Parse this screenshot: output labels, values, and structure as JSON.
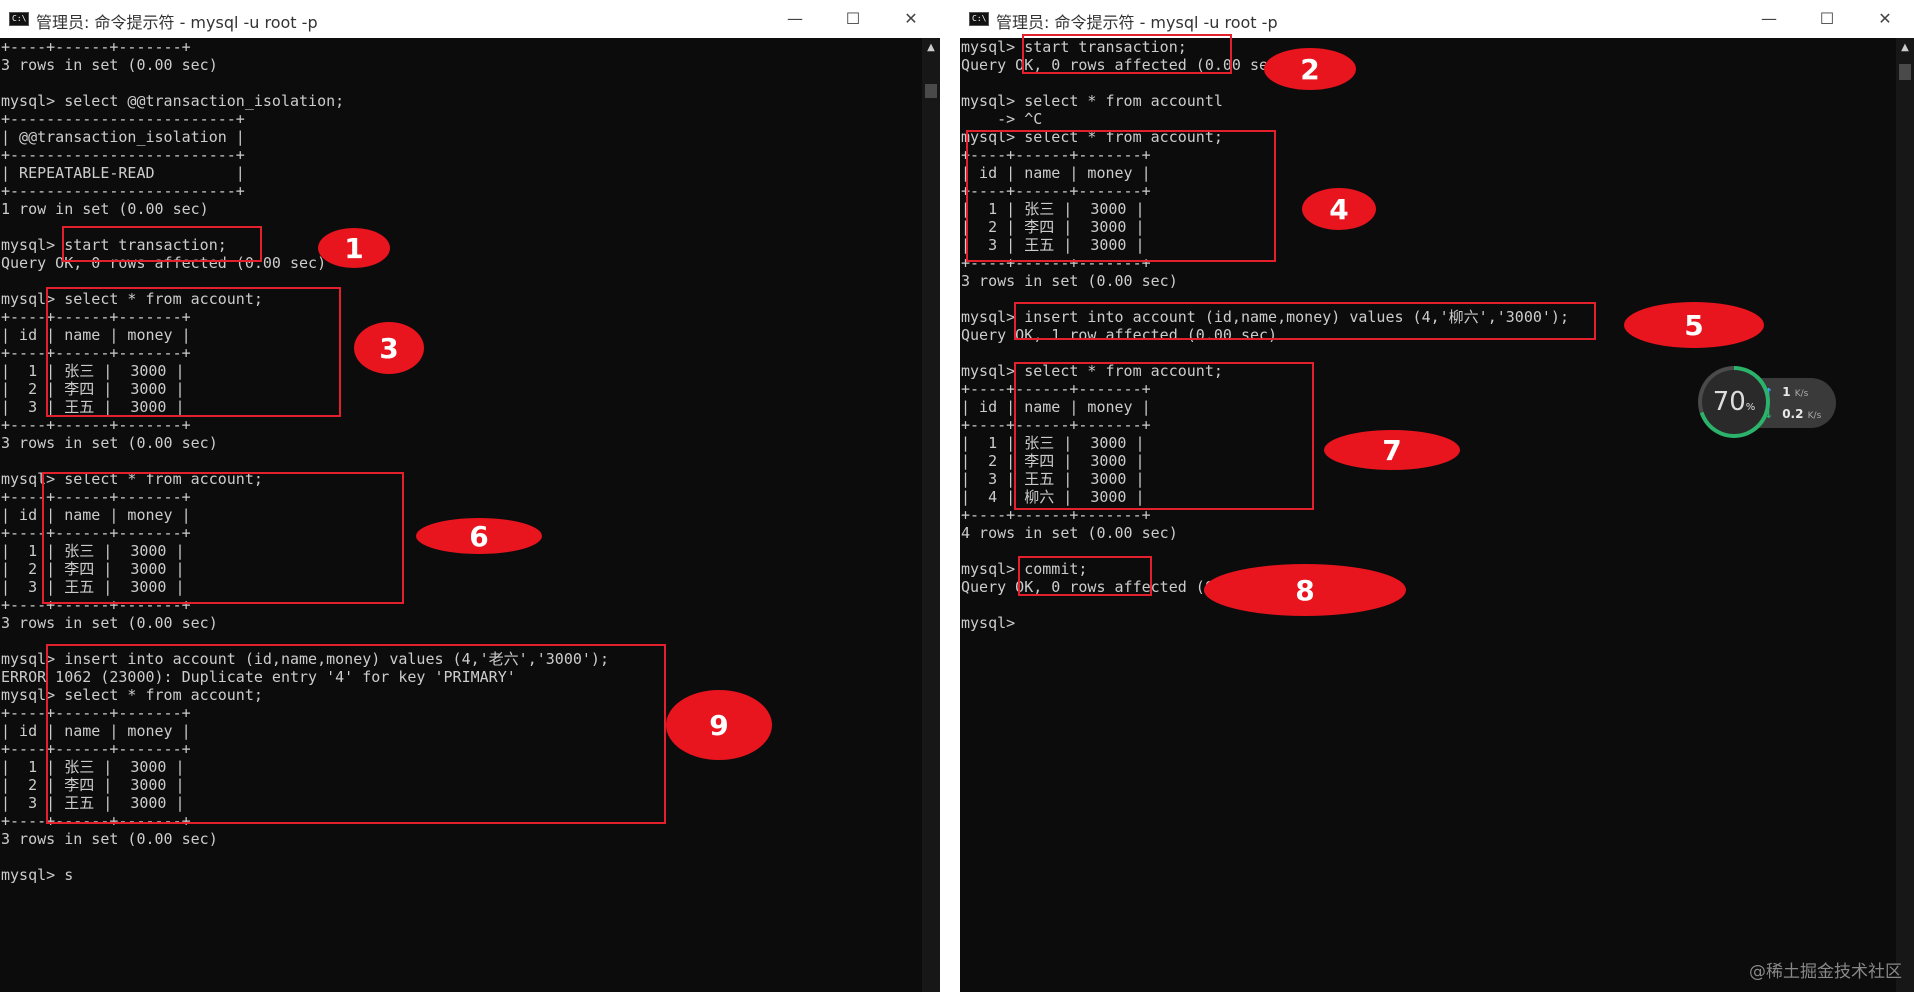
{
  "left_window": {
    "title": "管理员: 命令提示符 - mysql  -u root -p",
    "app_icon_label": "C:\\",
    "controls": {
      "minimize": "—",
      "maximize": "☐",
      "close": "✕"
    },
    "lines": [
      "+----+------+-------+",
      "3 rows in set (0.00 sec)",
      "",
      "mysql> select @@transaction_isolation;",
      "+-------------------------+",
      "| @@transaction_isolation |",
      "+-------------------------+",
      "| REPEATABLE-READ         |",
      "+-------------------------+",
      "1 row in set (0.00 sec)",
      "",
      "mysql> start transaction;",
      "Query OK, 0 rows affected (0.00 sec)",
      "",
      "mysql> select * from account;",
      "+----+------+-------+",
      "| id | name | money |",
      "+----+------+-------+",
      "|  1 | 张三 |  3000 |",
      "|  2 | 李四 |  3000 |",
      "|  3 | 王五 |  3000 |",
      "+----+------+-------+",
      "3 rows in set (0.00 sec)",
      "",
      "mysql> select * from account;",
      "+----+------+-------+",
      "| id | name | money |",
      "+----+------+-------+",
      "|  1 | 张三 |  3000 |",
      "|  2 | 李四 |  3000 |",
      "|  3 | 王五 |  3000 |",
      "+----+------+-------+",
      "3 rows in set (0.00 sec)",
      "",
      "mysql> insert into account (id,name,money) values (4,'老六','3000');",
      "ERROR 1062 (23000): Duplicate entry '4' for key 'PRIMARY'",
      "mysql> select * from account;",
      "+----+------+-------+",
      "| id | name | money |",
      "+----+------+-------+",
      "|  1 | 张三 |  3000 |",
      "|  2 | 李四 |  3000 |",
      "|  3 | 王五 |  3000 |",
      "+----+------+-------+",
      "3 rows in set (0.00 sec)",
      "",
      "mysql> s"
    ]
  },
  "right_window": {
    "title": "管理员: 命令提示符 - mysql  -u root -p",
    "app_icon_label": "C:\\",
    "controls": {
      "minimize": "—",
      "maximize": "☐",
      "close": "✕"
    },
    "lines": [
      "mysql> start transaction;",
      "Query OK, 0 rows affected (0.00 sec)",
      "",
      "mysql> select * from accountl",
      "    -> ^C",
      "mysql> select * from account;",
      "+----+------+-------+",
      "| id | name | money |",
      "+----+------+-------+",
      "|  1 | 张三 |  3000 |",
      "|  2 | 李四 |  3000 |",
      "|  3 | 王五 |  3000 |",
      "+----+------+-------+",
      "3 rows in set (0.00 sec)",
      "",
      "mysql> insert into account (id,name,money) values (4,'柳六','3000');",
      "Query OK, 1 row affected (0.00 sec)",
      "",
      "mysql> select * from account;",
      "+----+------+-------+",
      "| id | name | money |",
      "+----+------+-------+",
      "|  1 | 张三 |  3000 |",
      "|  2 | 李四 |  3000 |",
      "|  3 | 王五 |  3000 |",
      "|  4 | 柳六 |  3000 |",
      "+----+------+-------+",
      "4 rows in set (0.00 sec)",
      "",
      "mysql> commit;",
      "Query OK, 0 rows affected (0.00 sec)",
      "",
      "mysql> "
    ]
  },
  "annotations": [
    "1",
    "2",
    "3",
    "4",
    "5",
    "6",
    "7",
    "8",
    "9"
  ],
  "net_monitor": {
    "percent": 70,
    "percent_value": "70",
    "percent_sign": "%",
    "upload_value": "1",
    "upload_unit": "K/s",
    "download_value": "0.2",
    "download_unit": "K/s",
    "upload_arrow": "↑",
    "download_arrow": "↓",
    "upload_color": "#3aa0ff",
    "download_color": "#2bb36b"
  },
  "watermark": "@稀土掘金技术社区",
  "colors": {
    "highlight": "#e3202c",
    "badge": "#e8141e",
    "console_bg": "#0c0c0c",
    "console_fg": "#cccccc"
  }
}
